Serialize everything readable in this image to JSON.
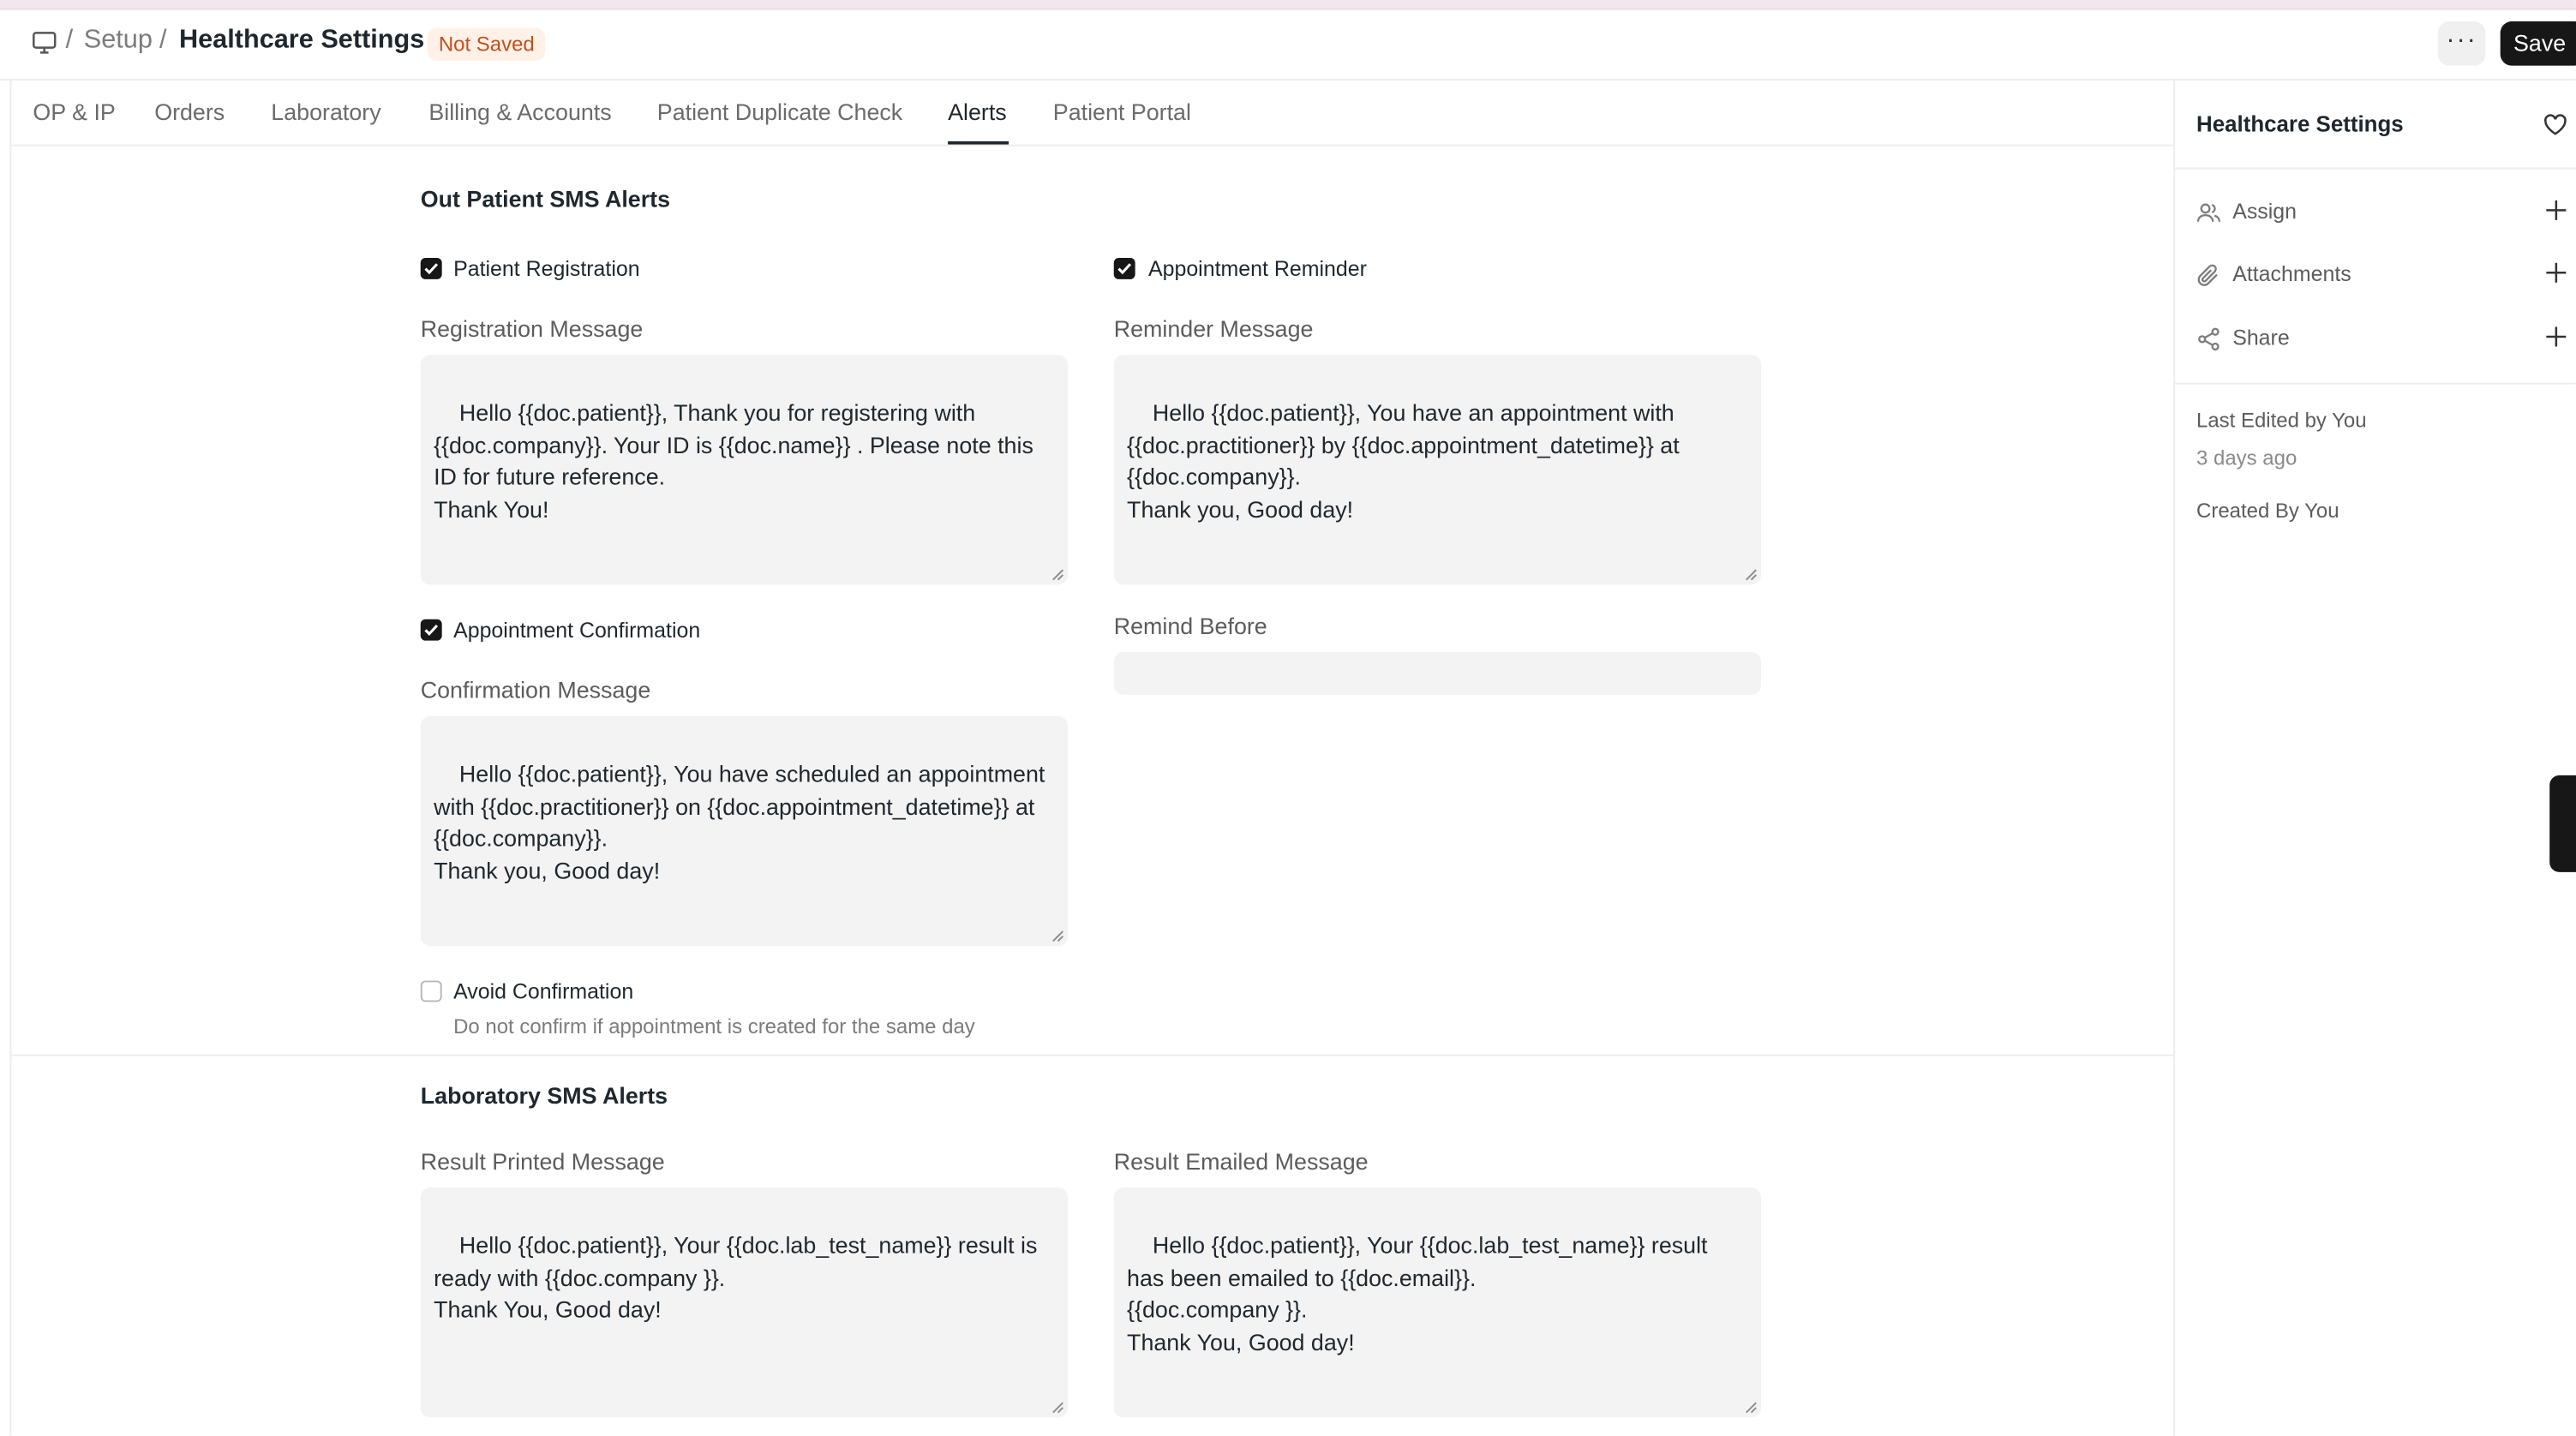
{
  "header": {
    "breadcrumb": [
      "Setup"
    ],
    "separator": "/",
    "title": "Healthcare Settings",
    "status_badge": "Not Saved",
    "menu_label": "···",
    "save_label": "Save"
  },
  "tabs": [
    {
      "label": "OP & IP"
    },
    {
      "label": "Orders"
    },
    {
      "label": "Laboratory"
    },
    {
      "label": "Billing & Accounts"
    },
    {
      "label": "Patient Duplicate Check"
    },
    {
      "label": "Alerts",
      "active": true
    },
    {
      "label": "Patient Portal"
    }
  ],
  "out_patient": {
    "title": "Out Patient SMS Alerts",
    "patient_registration": {
      "label": "Patient Registration",
      "checked": true
    },
    "registration_message": {
      "label": "Registration Message",
      "value": "Hello {{doc.patient}}, Thank you for registering with {{doc.company}}. Your ID is {{doc.name}} . Please note this ID for future reference.\nThank You!"
    },
    "appointment_reminder": {
      "label": "Appointment Reminder",
      "checked": true
    },
    "reminder_message": {
      "label": "Reminder Message",
      "value": "Hello {{doc.patient}}, You have an appointment with {{doc.practitioner}} by {{doc.appointment_datetime}} at {{doc.company}}.\nThank you, Good day!"
    },
    "appointment_confirmation": {
      "label": "Appointment Confirmation",
      "checked": true
    },
    "confirmation_message": {
      "label": "Confirmation Message",
      "value": "Hello {{doc.patient}}, You have scheduled an appointment with {{doc.practitioner}} on {{doc.appointment_datetime}} at  {{doc.company}}.\nThank you, Good day!"
    },
    "remind_before": {
      "label": "Remind Before",
      "value": ""
    },
    "avoid_confirmation": {
      "label": "Avoid Confirmation",
      "checked": false,
      "description": "Do not confirm if appointment is created for the same day"
    }
  },
  "laboratory": {
    "title": "Laboratory SMS Alerts",
    "result_printed": {
      "label": "Result Printed Message",
      "value": "Hello {{doc.patient}}, Your {{doc.lab_test_name}} result is ready with {{doc.company }}.\nThank You, Good day!"
    },
    "result_emailed": {
      "label": "Result Emailed Message",
      "value": "Hello {{doc.patient}}, Your {{doc.lab_test_name}} result has been emailed to {{doc.email}}.\n{{doc.company }}.\nThank You, Good day!"
    }
  },
  "sidebar": {
    "title": "Healthcare Settings",
    "items": [
      {
        "label": "Assign",
        "icon": "users-icon"
      },
      {
        "label": "Attachments",
        "icon": "paperclip-icon"
      },
      {
        "label": "Share",
        "icon": "share-icon"
      }
    ],
    "last_edited": "Last Edited by You",
    "last_edited_time": "3 days ago",
    "created_by": "Created By You"
  },
  "colors": {
    "primary": "#171717",
    "badge_bg": "#fff1e7",
    "badge_text": "#c4501c",
    "field_bg": "#f3f3f3"
  }
}
